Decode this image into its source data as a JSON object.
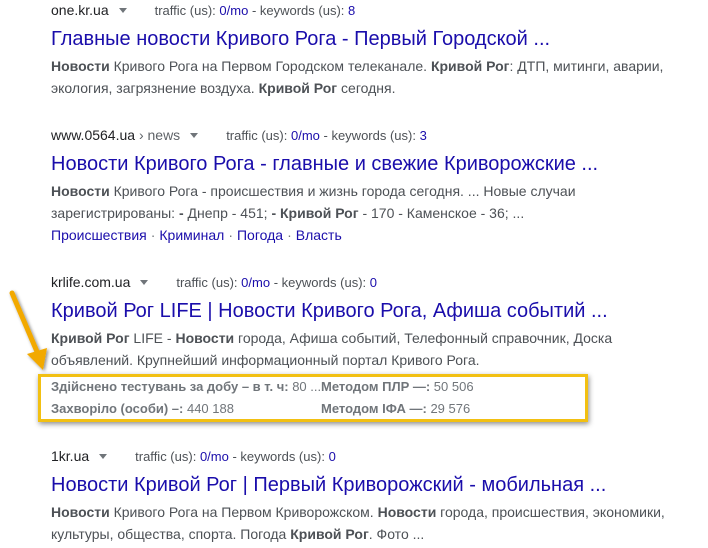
{
  "results": [
    {
      "domain": "one.kr.ua",
      "path": "",
      "traffic_label": "traffic (us):",
      "traffic_value": "0/mo",
      "keywords_label": "- keywords (us):",
      "keywords_value": "8",
      "title": "Главные новости Кривого Рога - Первый Городской ...",
      "snippet": [
        {
          "t": "Новости",
          "b": true
        },
        {
          "t": " Кривого Рога на Первом Городском телеканале. ",
          "b": false
        },
        {
          "t": "Кривой Рог",
          "b": true
        },
        {
          "t": ": ДТП, митинги, аварии, экология, загрязнение воздуха. ",
          "b": false
        },
        {
          "t": "Кривой Рог",
          "b": true
        },
        {
          "t": " сегодня.",
          "b": false
        }
      ]
    },
    {
      "domain": "www.0564.ua",
      "path": " › news",
      "traffic_label": "traffic (us):",
      "traffic_value": "0/mo",
      "keywords_label": "- keywords (us):",
      "keywords_value": "3",
      "title": "Новости Кривого Рога - главные и свежие Криворожские ...",
      "snippet": [
        {
          "t": "Новости",
          "b": true
        },
        {
          "t": " Кривого Рога - происшествия и жизнь города сегодня. ... Новые случаи зарегистрированы: ",
          "b": false
        },
        {
          "t": "-",
          "b": true
        },
        {
          "t": " Днепр - 451; ",
          "b": false
        },
        {
          "t": "-",
          "b": true
        },
        {
          "t": " ",
          "b": false
        },
        {
          "t": "Кривой Рог",
          "b": true
        },
        {
          "t": " - 170 - Каменское - 36; ...",
          "b": false
        }
      ],
      "sitelinks": [
        "Происшествия",
        "Криминал",
        "Погода",
        "Власть"
      ],
      "sitelink_sep": "·"
    },
    {
      "domain": "krlife.com.ua",
      "path": "",
      "traffic_label": "traffic (us):",
      "traffic_value": "0/mo",
      "keywords_label": "- keywords (us):",
      "keywords_value": "0",
      "title": "Кривой Рог LIFE | Новости Кривого Рога, Афиша событий ...",
      "snippet": [
        {
          "t": "Кривой Рог",
          "b": true
        },
        {
          "t": " LIFE - ",
          "b": false
        },
        {
          "t": "Новости",
          "b": true
        },
        {
          "t": " города, Афиша событий, Телефонный справочник, Доска объявлений. Крупнейший информационный портал Кривого Рога.",
          "b": false
        }
      ]
    },
    {
      "domain": "1kr.ua",
      "path": "",
      "traffic_label": "traffic (us):",
      "traffic_value": "0/mo",
      "keywords_label": "- keywords (us):",
      "keywords_value": "0",
      "title": "Новости Кривой Рог | Первый Криворожский - мобильная ...",
      "snippet": [
        {
          "t": "Новости",
          "b": true
        },
        {
          "t": " Кривого Рога на Первом Криворожском. ",
          "b": false
        },
        {
          "t": "Новости",
          "b": true
        },
        {
          "t": " города, происшествия, экономики, культуры, общества, спорта. Погода ",
          "b": false
        },
        {
          "t": "Кривой Рог",
          "b": true
        },
        {
          "t": ". Фото ...",
          "b": false
        }
      ]
    }
  ],
  "rich_snippet": {
    "rows": [
      [
        {
          "label": "Здійснено тестувань за добу – в т. ч:",
          "value": " 80 ..."
        },
        {
          "label": "Методом ПЛР —:",
          "value": " 50 506"
        }
      ],
      [
        {
          "label": "Захворіло (особи) –:",
          "value": " 440 188"
        },
        {
          "label": "Методом ІФА —:",
          "value": " 29 576"
        }
      ]
    ]
  },
  "colors": {
    "link": "#1a0dab",
    "highlight": "#f2c012",
    "arrow": "#f2a900"
  }
}
